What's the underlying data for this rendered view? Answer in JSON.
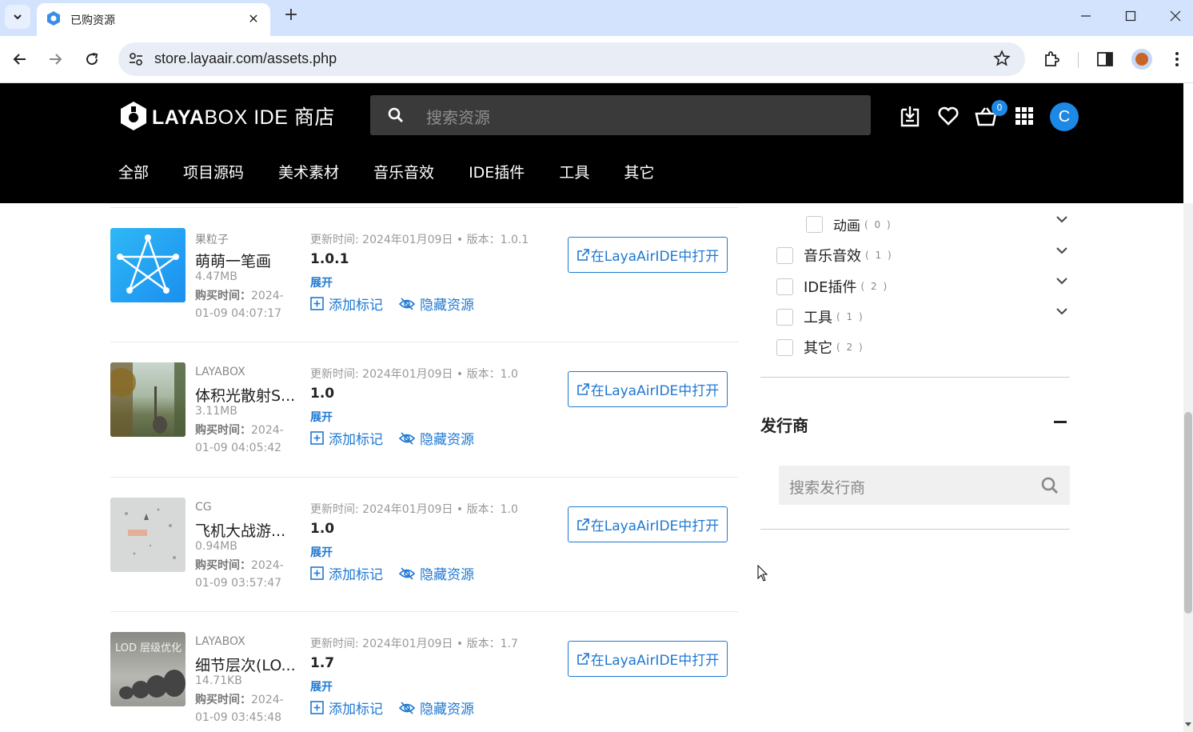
{
  "browser": {
    "tab_title": "已购资源",
    "url": "store.layaair.com/assets.php"
  },
  "header": {
    "logo_bold": "LAYA",
    "logo_rest": "BOX IDE 商店",
    "search_placeholder": "搜索资源",
    "cart_count": "0",
    "avatar_letter": "C",
    "nav": [
      "全部",
      "项目源码",
      "美术素材",
      "音乐音效",
      "IDE插件",
      "工具",
      "其它"
    ]
  },
  "items": [
    {
      "publisher": "果粒子",
      "title": "萌萌一笔画",
      "size": "4.47MB",
      "bought_label": "购买时间：",
      "bought_time": "2024-01-09 04:07:17",
      "update": "更新时间: 2024年01月09日 • 版本：1.0.1",
      "version": "1.0.1"
    },
    {
      "publisher": "LAYABOX",
      "title": "体积光散射S...",
      "size": "3.11MB",
      "bought_label": "购买时间：",
      "bought_time": "2024-01-09 04:05:42",
      "update": "更新时间: 2024年01月09日 • 版本：1.0",
      "version": "1.0"
    },
    {
      "publisher": "CG",
      "title": "飞机大战游...",
      "size": "0.94MB",
      "bought_label": "购买时间：",
      "bought_time": "2024-01-09 03:57:47",
      "update": "更新时间: 2024年01月09日 • 版本：1.0",
      "version": "1.0"
    },
    {
      "publisher": "LAYABOX",
      "title": "细节层次(LO...",
      "size": "14.71KB",
      "bought_label": "购买时间：",
      "bought_time": "2024-01-09 03:45:48",
      "update": "更新时间: 2024年01月09日 • 版本：1.7",
      "version": "1.7"
    }
  ],
  "item_labels": {
    "expand": "展开",
    "add_mark": "添加标记",
    "hide": "隐藏资源",
    "open": "在LayaAirIDE中打开"
  },
  "thumb_text": {
    "lod": "LOD 层级优化"
  },
  "sidebar": {
    "filters": [
      {
        "label": "动画",
        "count": "( 0 )"
      },
      {
        "label": "音乐音效",
        "count": "( 1 )"
      },
      {
        "label": "IDE插件",
        "count": "( 2 )"
      },
      {
        "label": "工具",
        "count": "( 1 )"
      },
      {
        "label": "其它",
        "count": "( 2 )"
      }
    ],
    "publisher_title": "发行商",
    "publisher_placeholder": "搜索发行商"
  },
  "colors": {
    "accent": "#1e78d2",
    "header_bg": "#000000",
    "tabstrip_bg": "#d3e3fd"
  }
}
